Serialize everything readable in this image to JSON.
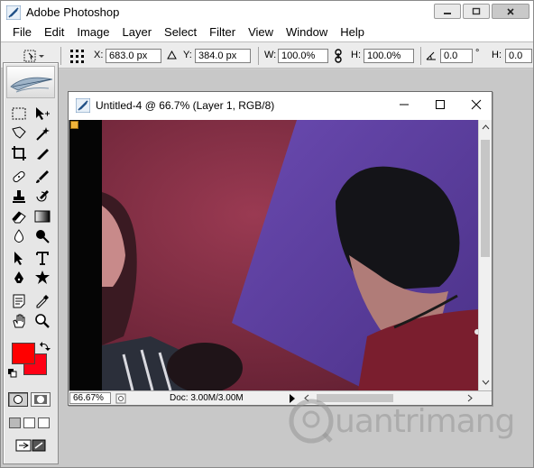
{
  "app": {
    "title": "Adobe Photoshop",
    "logo_icon": "photoshop-feather-icon"
  },
  "window_controls": {
    "minimize_icon": "minimize-icon",
    "maximize_icon": "maximize-icon",
    "close_icon": "close-icon"
  },
  "menu": [
    "File",
    "Edit",
    "Image",
    "Layer",
    "Select",
    "Filter",
    "View",
    "Window",
    "Help"
  ],
  "options_bar": {
    "x_label": "X:",
    "x_value": "683.0 px",
    "y_label": "Y:",
    "y_value": "384.0 px",
    "w_label": "W:",
    "w_value": "100.0%",
    "h_label": "H:",
    "h_value": "100.0%",
    "angle_value": "0.0",
    "angle_unit": "°",
    "h_skew_label": "H:",
    "h_skew_value": "0.0"
  },
  "colors": {
    "foreground": "#ff0000",
    "background": "#ff0015"
  },
  "document": {
    "title": "Untitled-4 @ 66.7% (Layer 1, RGB/8)",
    "zoom": "66.67%",
    "doc_info": "Doc: 3.00M/3.00M"
  },
  "watermark": {
    "text": "uantrimang"
  }
}
